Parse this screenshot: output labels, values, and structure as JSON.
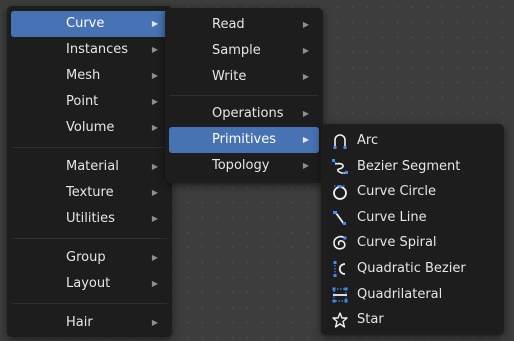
{
  "menu_level1": {
    "items": [
      {
        "label": "Curve",
        "active": true
      },
      {
        "label": "Instances"
      },
      {
        "label": "Mesh"
      },
      {
        "label": "Point"
      },
      {
        "label": "Volume"
      },
      {
        "label": "Material"
      },
      {
        "label": "Texture"
      },
      {
        "label": "Utilities"
      },
      {
        "label": "Group"
      },
      {
        "label": "Layout"
      },
      {
        "label": "Hair"
      }
    ]
  },
  "menu_level2": {
    "items": [
      {
        "label": "Read"
      },
      {
        "label": "Sample"
      },
      {
        "label": "Write"
      },
      {
        "label": "Operations"
      },
      {
        "label": "Primitives",
        "active": true
      },
      {
        "label": "Topology"
      }
    ]
  },
  "menu_level3": {
    "items": [
      {
        "label": "Arc",
        "icon": "arc-icon"
      },
      {
        "label": "Bezier Segment",
        "icon": "bezier-segment-icon"
      },
      {
        "label": "Curve Circle",
        "icon": "curve-circle-icon"
      },
      {
        "label": "Curve Line",
        "icon": "curve-line-icon"
      },
      {
        "label": "Curve Spiral",
        "icon": "curve-spiral-icon"
      },
      {
        "label": "Quadratic Bezier",
        "icon": "quadratic-bezier-icon"
      },
      {
        "label": "Quadrilateral",
        "icon": "quadrilateral-icon"
      },
      {
        "label": "Star",
        "icon": "star-icon"
      }
    ]
  },
  "submenu_arrow": "▶",
  "colors": {
    "menu_bg": "#1d1d1d",
    "highlight": "#4772b3",
    "canvas_bg": "#3d3d3d",
    "icon_blue": "#3f8cff",
    "text": "#e6e6e6"
  }
}
